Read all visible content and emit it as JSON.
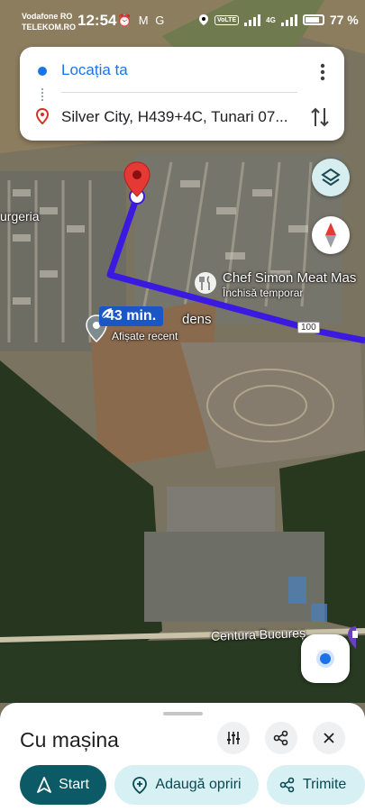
{
  "status_bar": {
    "carrier_line1": "Vodafone RO",
    "carrier_line2": "TELEKOM.RO",
    "time": "12:54",
    "app_icons": "⏰ M G",
    "volte": "VoLTE",
    "network": "4G",
    "battery": "77 %"
  },
  "directions": {
    "from": "Locația ta",
    "to": "Silver City, H439+4C, Tunari 07..."
  },
  "map": {
    "labels": {
      "burgeria": "urgeria",
      "poi_name": "Chef Simon Meat Mas",
      "poi_status": "Închisă temporar",
      "place_suffix": "dens",
      "recent": "Afișate recent",
      "road_number": "100",
      "road_name": "Centura Bucureș"
    },
    "route_time": "43 min."
  },
  "bottom_sheet": {
    "mode_title": "Cu mașina",
    "start_label": "Start",
    "add_stops_label": "Adaugă opriri",
    "share_label": "Trimite"
  },
  "colors": {
    "route": "#3a19e0",
    "accent_blue": "#1a73e8",
    "start_bg": "#0b5a66",
    "chip_bg": "#d6f0f3",
    "pin_red": "#e53935"
  }
}
